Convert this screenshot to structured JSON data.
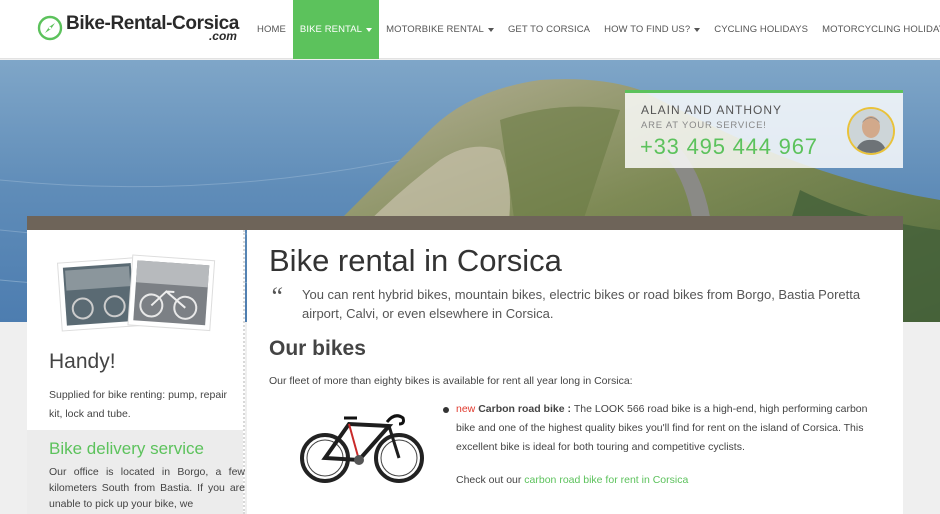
{
  "logo": {
    "main": "Bike-Rental-Corsica",
    "sub": ".com"
  },
  "nav": [
    {
      "label": "HOME",
      "active": false,
      "caret": false
    },
    {
      "label": "BIKE RENTAL",
      "active": true,
      "caret": true
    },
    {
      "label": "MOTORBIKE RENTAL",
      "active": false,
      "caret": true
    },
    {
      "label": "GET TO CORSICA",
      "active": false,
      "caret": false
    },
    {
      "label": "HOW TO FIND US?",
      "active": false,
      "caret": true
    },
    {
      "label": "CYCLING HOLIDAYS",
      "active": false,
      "caret": false
    },
    {
      "label": "MOTORCYCLING HOLIDAYS",
      "active": false,
      "caret": false
    }
  ],
  "contact": {
    "name": "ALAIN AND ANTHONY",
    "tagline": "ARE AT YOUR SERVICE!",
    "phone": "+33 495 444 967"
  },
  "sidebar": {
    "handy_title": "Handy!",
    "handy_text": "Supplied for bike renting: pump, repair kit, lock and tube.",
    "delivery_title": "Bike delivery service",
    "delivery_text": "Our office is located in Borgo, a few kilometers South from Bastia. If you are unable to pick up your bike, we"
  },
  "main": {
    "title": "Bike rental in Corsica",
    "quote_mark": "“",
    "intro": "You can rent hybrid bikes, mountain bikes, electric bikes or road bikes from Borgo, Bastia Poretta airport, Calvi, or even elsewhere in Corsica.",
    "subtitle": "Our bikes",
    "fleet_text": "Our fleet of more than eighty bikes is available for rent all year long in Corsica:",
    "bike": {
      "new_tag": "new",
      "name": "Carbon road bike",
      "sep": " : ",
      "desc": "The LOOK 566 road bike is a high-end, high performing carbon bike and one of the highest quality bikes you'll find for rent on the island of Corsica. This excellent bike is ideal for both touring and competitive cyclists.",
      "checkout_prefix": "Check out our ",
      "checkout_link": "carbon road bike for rent in Corsica"
    }
  },
  "colors": {
    "accent": "#5cc25c",
    "new": "#e03a2e",
    "avatar_ring": "#e9c23a"
  }
}
